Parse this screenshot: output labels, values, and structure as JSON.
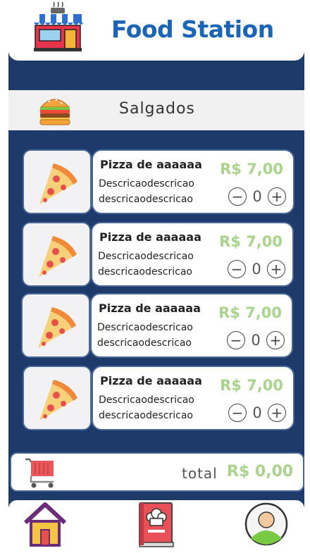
{
  "header": {
    "title": "Food Station",
    "logo_icon": "store-icon"
  },
  "category": {
    "label": "Salgados",
    "icon": "burger-icon"
  },
  "items": [
    {
      "name": "Pizza de aaaaaa",
      "desc1": "Descricaodescricao",
      "desc2": "descricaodescricao",
      "price": "R$ 7,00",
      "qty": "0"
    },
    {
      "name": "Pizza de aaaaaa",
      "desc1": "Descricaodescricao",
      "desc2": "descricaodescricao",
      "price": "R$ 7,00",
      "qty": "0"
    },
    {
      "name": "Pizza de aaaaaa",
      "desc1": "Descricaodescricao",
      "desc2": "descricaodescricao",
      "price": "R$ 7,00",
      "qty": "0"
    },
    {
      "name": "Pizza de aaaaaa",
      "desc1": "Descricaodescricao",
      "desc2": "descricaodescricao",
      "price": "R$ 7,00",
      "qty": "0"
    }
  ],
  "total": {
    "label": "total",
    "value": "R$ 0,00"
  },
  "nav": {
    "home_icon": "home-icon",
    "menu_icon": "recipe-book-icon",
    "profile_icon": "user-avatar-icon"
  },
  "colors": {
    "navy": "#1e3a6b",
    "brand_blue": "#1b65b8",
    "price_green": "#a8d48b"
  }
}
